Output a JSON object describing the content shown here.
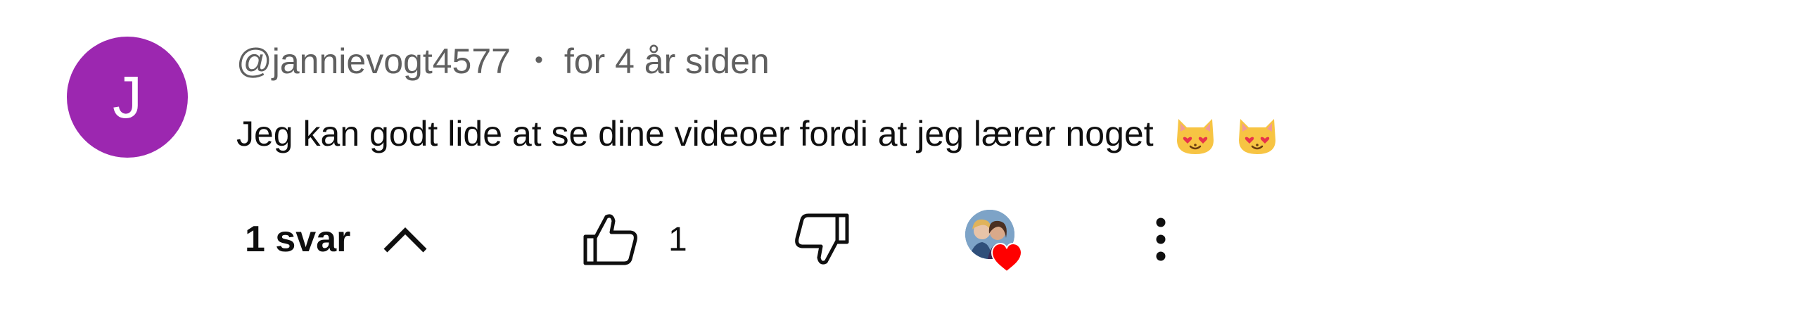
{
  "comment": {
    "avatar_letter": "J",
    "avatar_color": "#9c27b0",
    "author": "@jannievogt4577",
    "separator": "•",
    "timestamp": "for 4 år siden",
    "text": "Jeg kan godt lide at se dine videoer fordi at jeg lærer noget",
    "emojis": [
      "smiling-cat-with-heart-eyes-icon",
      "smiling-cat-with-heart-eyes-icon"
    ]
  },
  "actions": {
    "replies_label": "1 svar",
    "replies_icon": "chevron-up-icon",
    "like_icon": "thumbs-up-icon",
    "like_count": "1",
    "dislike_icon": "thumbs-down-icon",
    "creator_heart_icon": "creator-heart-icon",
    "heart_color": "#ff0000",
    "more_icon": "more-vertical-icon"
  }
}
